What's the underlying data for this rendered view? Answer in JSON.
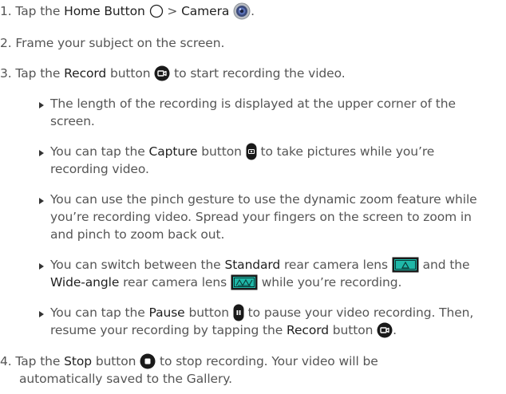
{
  "step1": {
    "num": "1.",
    "pre": "Tap the",
    "home": "Home Button",
    "gt": ">",
    "camera": "Camera",
    "post": "."
  },
  "step2": {
    "num": "2.",
    "text": "Frame your subject on the screen."
  },
  "step3": {
    "num": "3.",
    "pre": "Tap the",
    "record": "Record",
    "post": "button",
    "post2": "to start recording the video."
  },
  "bullet1": {
    "line1": "The length of the recording is displayed at the upper corner of the",
    "line2": "screen."
  },
  "bullet2": {
    "pre": "You can tap the",
    "capture": "Capture",
    "mid": "button",
    "post": "to take pictures while you’re",
    "line2": "recording video."
  },
  "bullet3": {
    "line1": "You can use the pinch gesture to use the dynamic zoom feature while",
    "line2": "you’re recording video. Spread your fingers on the screen to zoom in",
    "line3": "and pinch to zoom back out."
  },
  "bullet4": {
    "pre": "You can switch between the",
    "standard": "Standard",
    "mid": "rear camera lens",
    "post": "and the",
    "wide": "Wide-angle",
    "mid2": "rear camera lens",
    "post2": "while you’re recording."
  },
  "bullet5": {
    "pre": "You can tap the",
    "pause": "Pause",
    "mid": "button",
    "post": "to pause your video recording. Then,",
    "line2pre": "resume your recording by tapping the",
    "record": "Record",
    "line2post": "button",
    "line2end": "."
  },
  "step4": {
    "num": "4.",
    "pre": "Tap the",
    "stop": "Stop",
    "mid": "button",
    "post": "to stop recording. Your video will be",
    "line2": "automatically saved to the Gallery."
  },
  "colors": {
    "text": "#555555",
    "bold": "#1f1f1f",
    "icon_dark": "#1a1a1a",
    "lens_teal": "#1fb8a8"
  }
}
